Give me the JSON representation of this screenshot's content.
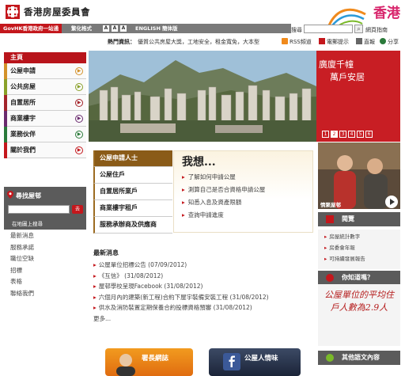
{
  "header": {
    "logo_text": "香港房屋委員會",
    "brand": "香港",
    "search_label": "搜尋",
    "search_placeholder": "",
    "search_go": "⌕",
    "site_guide": "網頁指南"
  },
  "navbar": {
    "gov_link": "GovHK香港政府一站通",
    "traditional": "繁化格式",
    "font_sizes": [
      "A",
      "A",
      "A"
    ],
    "english": "ENGLISH",
    "simplified": "簡体版"
  },
  "hotbar": {
    "label": "熱門資訊：",
    "text": "優質公共房屋大獎，工地安全，租金寬免，大本型",
    "rss": "RSS頻道",
    "alert": "電郵提示",
    "print": "直報",
    "share": "分享"
  },
  "sidebar": {
    "main": "主頁",
    "items": [
      {
        "label": "公屋申請",
        "color": "#d4922a"
      },
      {
        "label": "公共房屋",
        "color": "#8aa12a"
      },
      {
        "label": "自置居所",
        "color": "#a3242a"
      },
      {
        "label": "商業樓宇",
        "color": "#6a2b6e"
      },
      {
        "label": "業務伙伴",
        "color": "#2a7a3a"
      },
      {
        "label": "關於我們",
        "color": "#c4171c"
      }
    ],
    "finder_title": "尋找屋邨",
    "finder_go": "去",
    "finder_map": "在地圖上搜尋",
    "links": [
      "最新消息",
      "服務承諾",
      "職位空缺",
      "招標",
      "表格",
      "聯絡我們"
    ]
  },
  "hero": {
    "caption_line1": "廣廈千幢",
    "caption_line2": "萬戶安居",
    "slides": [
      "1",
      "2",
      "3",
      "4",
      "5",
      "6"
    ]
  },
  "services": {
    "items": [
      "公屋申請人士",
      "公屋住戶",
      "自置居所業戶",
      "商業樓宇租戶",
      "服務承辦商及供應商"
    ],
    "want_title": "我想...",
    "want_items": [
      "了解如何申請公屋",
      "測算自己是否合資格申請公屋",
      "知悉入息及資產限額",
      "查詢申請進度"
    ]
  },
  "news": {
    "title": "最新消息",
    "items": [
      "公屋單位招標公告 (07/09/2012)",
      "《互信》 (31/08/2012)",
      "屋邨學校呈現Facebook (31/08/2012)",
      "六個月內的建築(新工程)合約下屋宇裝備安裝工程 (31/08/2012)",
      "供水及消防裝置定期保養合約投標資格預審 (31/08/2012)"
    ],
    "more": "更多..."
  },
  "banners": {
    "director_blog": "署長網誌",
    "facebook": "公屋人情味"
  },
  "right": {
    "video_label": "情聚屋邨",
    "read_title": "閱覽",
    "read_items": [
      "房屋統計數字",
      "房委會年報",
      "可持續發展報告"
    ],
    "dyk_title": "你知道嗎？",
    "dyk_text": "公屋單位的平均住戶人數為2.9人",
    "other_lang": "其他語文內容"
  }
}
